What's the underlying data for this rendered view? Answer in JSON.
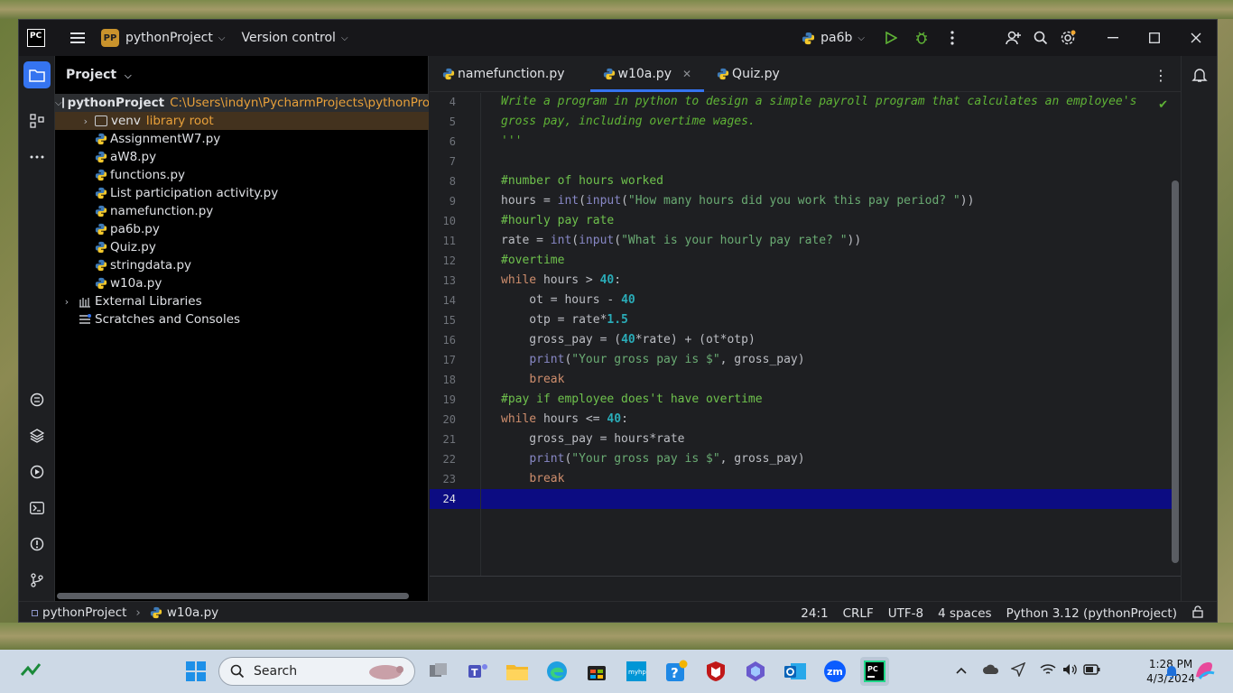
{
  "titlebar": {
    "project_badge": "PP",
    "project_name": "pythonProject",
    "vcs_label": "Version control",
    "run_config": "pa6b"
  },
  "project_panel": {
    "header": "Project",
    "root_name": "pythonProject",
    "root_path": "C:\\Users\\indyn\\PycharmProjects\\pythonProj",
    "venv_name": "venv",
    "venv_tag": "library root",
    "files": [
      "AssignmentW7.py",
      "aW8.py",
      "functions.py",
      "List participation activity.py",
      "namefunction.py",
      "pa6b.py",
      "Quiz.py",
      "stringdata.py",
      "w10a.py"
    ],
    "external_libraries": "External Libraries",
    "scratches": "Scratches and Consoles"
  },
  "tabs": [
    {
      "label": "namefunction.py"
    },
    {
      "label": "w10a.py"
    },
    {
      "label": "Quiz.py"
    }
  ],
  "editor": {
    "line_numbers": [
      "4",
      "5",
      "6",
      "7",
      "8",
      "9",
      "10",
      "11",
      "12",
      "13",
      "14",
      "15",
      "16",
      "17",
      "18",
      "19",
      "20",
      "21",
      "22",
      "23",
      "24"
    ],
    "current_line": "24"
  },
  "statusbar": {
    "crumb_project": "pythonProject",
    "crumb_file": "w10a.py",
    "position": "24:1",
    "line_sep": "CRLF",
    "encoding": "UTF-8",
    "indent": "4 spaces",
    "interpreter": "Python 3.12 (pythonProject)"
  },
  "taskbar": {
    "search_label": "Search",
    "time": "1:28 PM",
    "date": "4/3/2024"
  },
  "colors": {
    "accent": "#3574f0",
    "current_line": "#0c0c82",
    "selection": "#43321e"
  }
}
